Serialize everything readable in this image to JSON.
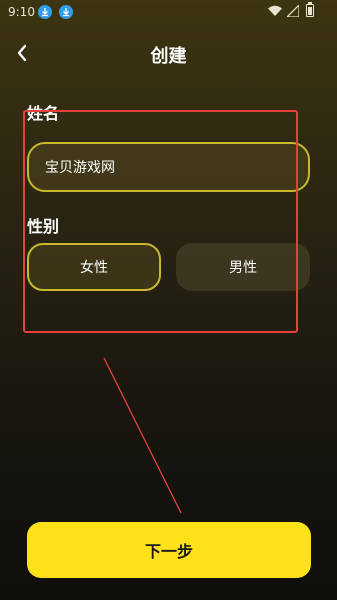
{
  "status_bar": {
    "time": "9:10",
    "icons": [
      "download-icon",
      "download-icon",
      "wifi-icon",
      "signal-icon",
      "battery-icon"
    ]
  },
  "header": {
    "title": "创建",
    "back_icon": "chevron-left-icon"
  },
  "form": {
    "name_label": "姓名",
    "name_value": "宝贝游戏网",
    "gender_label": "性别",
    "gender_options": [
      {
        "label": "女性",
        "selected": true
      },
      {
        "label": "男性",
        "selected": false
      }
    ]
  },
  "footer": {
    "next_label": "下一步"
  },
  "colors": {
    "accent": "#ffe11a",
    "selected_border": "#c9b82b",
    "annotation": "#e5413b"
  }
}
